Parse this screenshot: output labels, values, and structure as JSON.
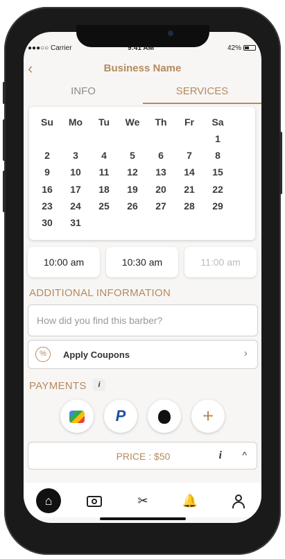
{
  "status": {
    "carrier": "●●●○○ Carrier",
    "time": "9:41 AM",
    "battery": "42%"
  },
  "header": {
    "back": "‹",
    "title": "Business Name"
  },
  "tabs": [
    {
      "label": "INFO"
    },
    {
      "label": "SERVICES"
    }
  ],
  "calendar": {
    "weekdays": [
      "Su",
      "Mo",
      "Tu",
      "We",
      "Th",
      "Fr",
      "Sa"
    ],
    "rows": [
      [
        "",
        "",
        "",
        "",
        "",
        "",
        "1"
      ],
      [
        "2",
        "3",
        "4",
        "5",
        "6",
        "7",
        "8"
      ],
      [
        "9",
        "10",
        "11",
        "12",
        "13",
        "14",
        "15"
      ],
      [
        "16",
        "17",
        "18",
        "19",
        "20",
        "21",
        "22"
      ],
      [
        "23",
        "24",
        "25",
        "26",
        "27",
        "28",
        "29"
      ],
      [
        "30",
        "31",
        "",
        "",
        "",
        "",
        ""
      ]
    ]
  },
  "slots": [
    "10:00 am",
    "10:30 am",
    "11:00 am"
  ],
  "additional": {
    "heading": "ADDITIONAL INFORMATION",
    "placeholder": "How did you find this barber?"
  },
  "coupon": {
    "label": "Apply Coupons",
    "icon": "%"
  },
  "payments": {
    "heading": "PAYMENTS",
    "info": "i"
  },
  "price": {
    "label": "PRICE : $50",
    "info": "i",
    "toggle": "^"
  },
  "nav": {
    "items": [
      "home-icon",
      "camera-icon",
      "scissors-icon",
      "bell-icon",
      "user-icon"
    ]
  }
}
